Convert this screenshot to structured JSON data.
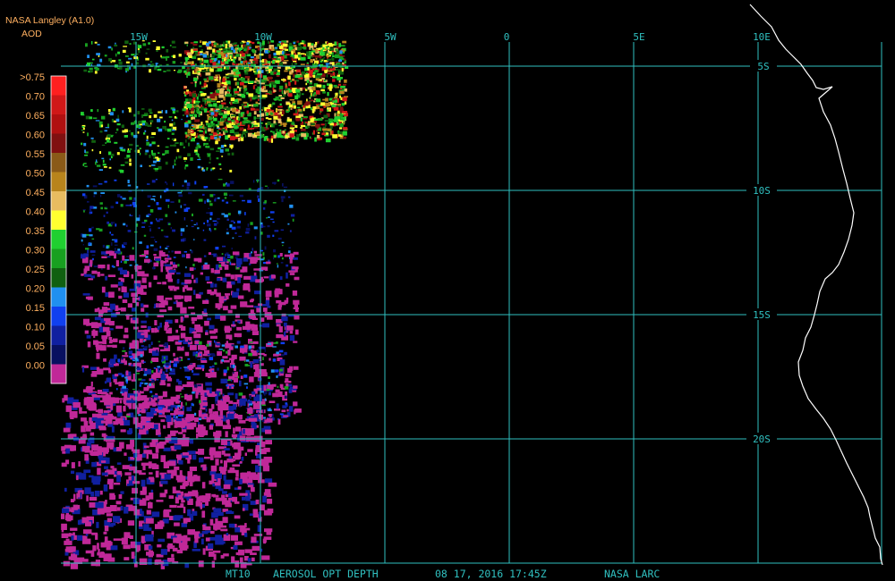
{
  "header": {
    "source": "NASA Langley (A1.0)",
    "variable": "AOD"
  },
  "legend": {
    "labels": [
      ">0.75",
      "0.70",
      "0.65",
      "0.60",
      "0.55",
      "0.50",
      "0.45",
      "0.40",
      "0.35",
      "0.30",
      "0.25",
      "0.20",
      "0.15",
      "0.10",
      "0.05",
      "0.00"
    ],
    "colors": [
      "#ff2020",
      "#d01818",
      "#b01010",
      "#801010",
      "#8a5a18",
      "#b8841c",
      "#e8bc60",
      "#ffff30",
      "#20d030",
      "#18a020",
      "#106010",
      "#2090f0",
      "#1040f0",
      "#1020a0",
      "#081060",
      "#c02898"
    ],
    "label_color": "#ffb060"
  },
  "map": {
    "grid_color": "#30c0c0",
    "coast_color": "#ffffff",
    "lon_labels": [
      "15W",
      "10W",
      "5W",
      "0",
      "5E",
      "10E"
    ],
    "lat_labels": [
      "5S",
      "10S",
      "15S",
      "20S"
    ]
  },
  "footer": {
    "product": "MT10",
    "title": "AEROSOL OPT DEPTH",
    "datetime": "08 17, 2016 17:45Z",
    "agency": "NASA LARC"
  }
}
